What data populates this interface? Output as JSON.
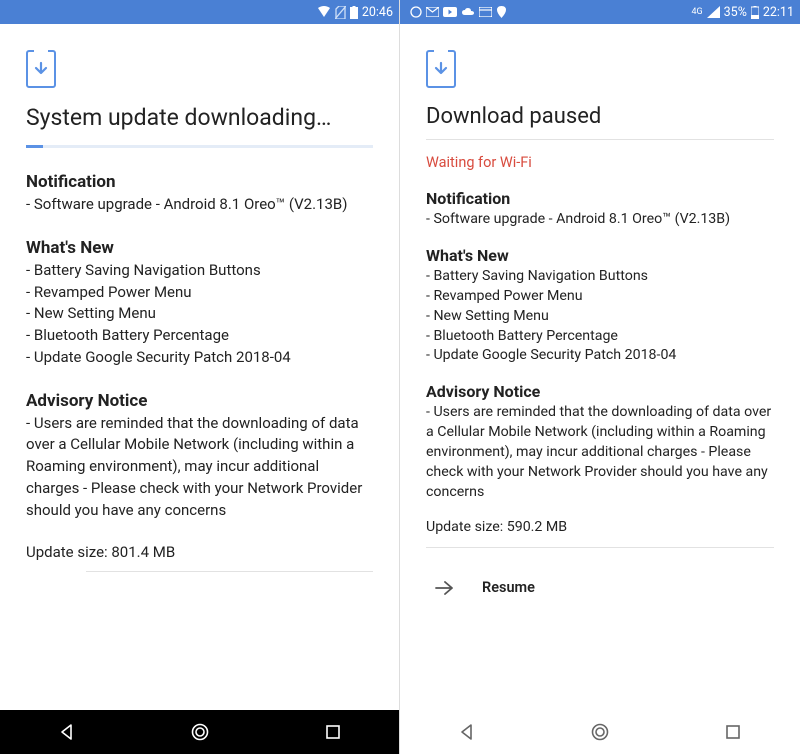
{
  "left": {
    "statusbar": {
      "time": "20:46"
    },
    "title": "System update downloading…",
    "notification": {
      "heading": "Notification",
      "text": "- Software upgrade - Android 8.1 Oreo™ (V2.13B)"
    },
    "whatsnew": {
      "heading": "What's New",
      "items": [
        "- Battery Saving Navigation Buttons",
        "- Revamped Power Menu",
        "- New Setting Menu",
        "- Bluetooth Battery Percentage",
        "- Update Google Security Patch 2018-04"
      ]
    },
    "advisory": {
      "heading": "Advisory Notice",
      "text": "- Users are reminded that the downloading of data over a Cellular Mobile Network (including within a Roaming environment), may incur additional charges - Please check with your Network Provider should you have any concerns"
    },
    "update_size": "Update size: 801.4 MB"
  },
  "right": {
    "statusbar": {
      "signal_type": "4G",
      "battery_pct": "35%",
      "time": "22:11"
    },
    "title": "Download paused",
    "wait_msg": "Waiting for Wi-Fi",
    "notification": {
      "heading": "Notification",
      "text": "- Software upgrade - Android 8.1 Oreo™ (V2.13B)"
    },
    "whatsnew": {
      "heading": "What's New",
      "items": [
        "- Battery Saving Navigation Buttons",
        "- Revamped Power Menu",
        "- New Setting Menu",
        "- Bluetooth Battery Percentage",
        "- Update Google Security Patch 2018-04"
      ]
    },
    "advisory": {
      "heading": "Advisory Notice",
      "text": "- Users are reminded that the downloading of data over a Cellular Mobile Network (including within a Roaming environment), may incur additional charges - Please check with your Network Provider should you have any concerns"
    },
    "update_size": "Update size: 590.2 MB",
    "resume_label": "Resume"
  }
}
